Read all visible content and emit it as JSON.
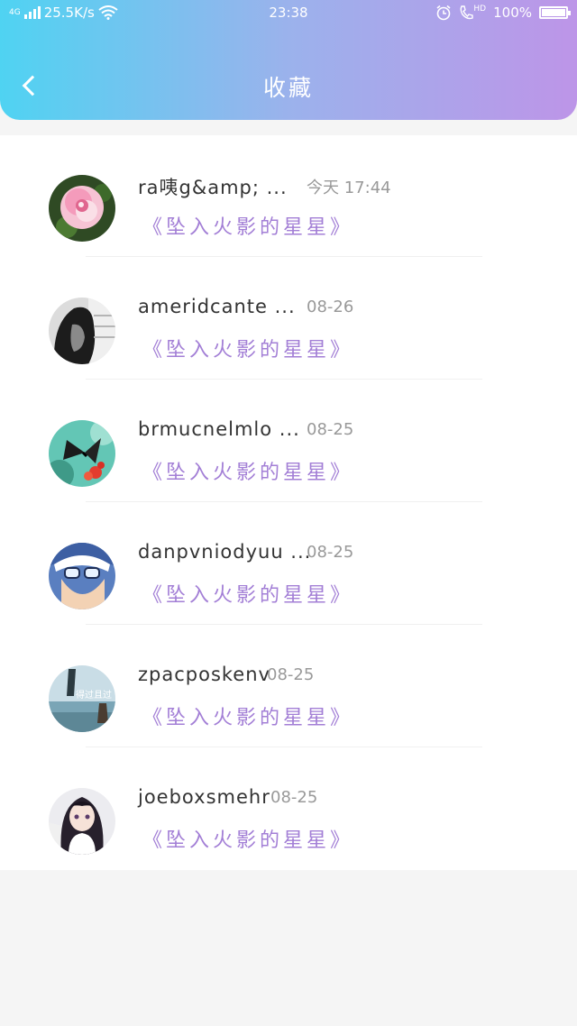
{
  "status_bar": {
    "network": "4G",
    "speed": "25.5K/s",
    "time": "23:38",
    "hd_label": "HD",
    "battery": "100%"
  },
  "header": {
    "title": "收藏"
  },
  "favorites": [
    {
      "name": "ra咦g&amp; ...",
      "time": "今天 17:44",
      "work": "《坠入火影的星星》",
      "avatar": "rose"
    },
    {
      "name": "ameridcante ...",
      "time": "08-26",
      "work": "《坠入火影的星星》",
      "avatar": "girl-dark"
    },
    {
      "name": "brmucnelmlo ...",
      "time": "08-25",
      "work": "《坠入火影的星星》",
      "avatar": "butterfly"
    },
    {
      "name": "danpvniodyuu ...",
      "time": "08-25",
      "work": "《坠入火影的星星》",
      "avatar": "anime-boy"
    },
    {
      "name": "zpacposkenv",
      "time": "08-25",
      "work": "《坠入火影的星星》",
      "avatar": "seaside",
      "avatar_text": "得过且过"
    },
    {
      "name": "joeboxsmehr",
      "time": "08-25",
      "work": "《坠入火影的星星》",
      "avatar": "anime-girl"
    }
  ]
}
